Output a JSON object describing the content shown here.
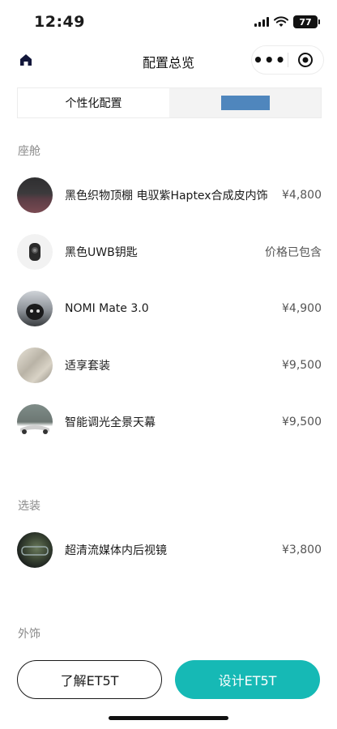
{
  "status_bar": {
    "time": "12:49",
    "battery": "77"
  },
  "nav": {
    "title": "配置总览",
    "more_label": "•••"
  },
  "tabs": [
    {
      "label": "个性化配置",
      "active": true
    },
    {
      "label": "",
      "active": false
    }
  ],
  "sections": {
    "cabin": {
      "label": "座舱",
      "items": [
        {
          "name": "黑色织物顶棚 电驭紫Haptex合成皮内饰",
          "price": "¥4,800"
        },
        {
          "name": "黑色UWB钥匙",
          "price": "价格已包含"
        },
        {
          "name": "NOMI Mate 3.0",
          "price": "¥4,900"
        },
        {
          "name": "适享套装",
          "price": "¥9,500"
        },
        {
          "name": "智能调光全景天幕",
          "price": "¥9,500"
        }
      ]
    },
    "options": {
      "label": "选装",
      "items": [
        {
          "name": "超清流媒体内后视镜",
          "price": "¥3,800"
        }
      ]
    },
    "exterior": {
      "label": "外饰"
    }
  },
  "actions": {
    "learn_label": "了解ET5T",
    "design_label": "设计ET5T"
  },
  "colors": {
    "accent": "#16b9b5",
    "tab_placeholder": "#4f86bd"
  }
}
